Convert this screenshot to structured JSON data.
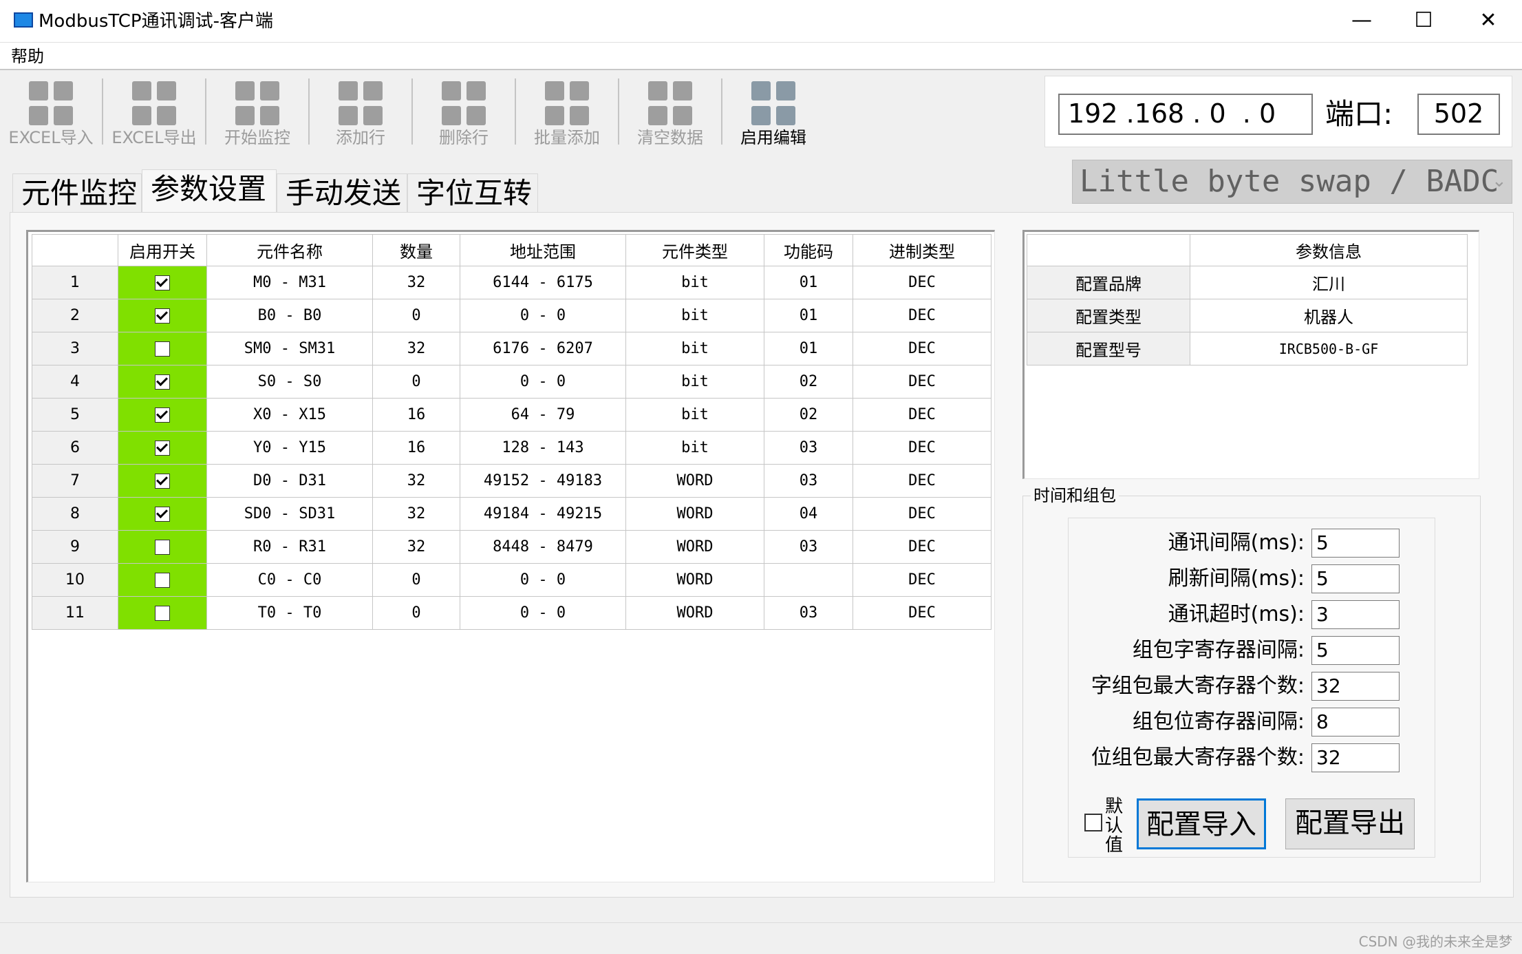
{
  "window": {
    "title": "ModbusTCP通讯调试-客户端",
    "minimize": "—",
    "maximize": "☐",
    "close": "✕"
  },
  "menu": {
    "help": "帮助"
  },
  "toolbar": [
    {
      "label": "EXCEL导入",
      "enabled": false
    },
    {
      "label": "EXCEL导出",
      "enabled": false
    },
    {
      "label": "开始监控",
      "enabled": false
    },
    {
      "label": "添加行",
      "enabled": false
    },
    {
      "label": "删除行",
      "enabled": false
    },
    {
      "label": "批量添加",
      "enabled": false
    },
    {
      "label": "清空数据",
      "enabled": false
    },
    {
      "label": "启用编辑",
      "enabled": true
    }
  ],
  "connection": {
    "ip": "192 .168 . 0  . 0",
    "port_label": "端口:",
    "port": "502"
  },
  "tabs": [
    "元件监控",
    "参数设置",
    "手动发送",
    "字位互转"
  ],
  "active_tab": 1,
  "byte_order": "Little byte swap / BADC",
  "table": {
    "headers": [
      "",
      "启用开关",
      "元件名称",
      "数量",
      "地址范围",
      "元件类型",
      "功能码",
      "进制类型"
    ],
    "rows": [
      {
        "no": "1",
        "on": true,
        "name": "M0 - M31",
        "count": "32",
        "range": "6144 - 6175",
        "type": "bit",
        "func": "01",
        "radix": "DEC"
      },
      {
        "no": "2",
        "on": true,
        "name": "B0 - B0",
        "count": "0",
        "range": "0 - 0",
        "type": "bit",
        "func": "01",
        "radix": "DEC"
      },
      {
        "no": "3",
        "on": false,
        "name": "SM0 - SM31",
        "count": "32",
        "range": "6176 - 6207",
        "type": "bit",
        "func": "01",
        "radix": "DEC"
      },
      {
        "no": "4",
        "on": true,
        "name": "S0 - S0",
        "count": "0",
        "range": "0 - 0",
        "type": "bit",
        "func": "02",
        "radix": "DEC"
      },
      {
        "no": "5",
        "on": true,
        "name": "X0 - X15",
        "count": "16",
        "range": "64 - 79",
        "type": "bit",
        "func": "02",
        "radix": "DEC"
      },
      {
        "no": "6",
        "on": true,
        "name": "Y0 - Y15",
        "count": "16",
        "range": "128 - 143",
        "type": "bit",
        "func": "03",
        "radix": "DEC"
      },
      {
        "no": "7",
        "on": true,
        "name": "D0 - D31",
        "count": "32",
        "range": "49152 - 49183",
        "type": "WORD",
        "func": "03",
        "radix": "DEC"
      },
      {
        "no": "8",
        "on": true,
        "name": "SD0 - SD31",
        "count": "32",
        "range": "49184 - 49215",
        "type": "WORD",
        "func": "04",
        "radix": "DEC"
      },
      {
        "no": "9",
        "on": false,
        "name": "R0 - R31",
        "count": "32",
        "range": "8448 - 8479",
        "type": "WORD",
        "func": "03",
        "radix": "DEC"
      },
      {
        "no": "10",
        "on": false,
        "name": "C0 - C0",
        "count": "0",
        "range": "0 - 0",
        "type": "WORD",
        "func": "",
        "radix": "DEC"
      },
      {
        "no": "11",
        "on": false,
        "name": "T0 - T0",
        "count": "0",
        "range": "0 - 0",
        "type": "WORD",
        "func": "03",
        "radix": "DEC"
      }
    ]
  },
  "params": {
    "header": "参数信息",
    "rows": [
      {
        "key": "配置品牌",
        "value": "汇川"
      },
      {
        "key": "配置类型",
        "value": "机器人"
      },
      {
        "key": "配置型号",
        "value": "IRCB500-B-GF"
      }
    ]
  },
  "timing": {
    "title": "时间和组包",
    "fields": [
      {
        "label": "通讯间隔(ms):",
        "value": "5"
      },
      {
        "label": "刷新间隔(ms):",
        "value": "5"
      },
      {
        "label": "通讯超时(ms):",
        "value": "3"
      },
      {
        "label": "组包字寄存器间隔:",
        "value": "5"
      },
      {
        "label": "字组包最大寄存器个数:",
        "value": "32"
      },
      {
        "label": "组包位寄存器间隔:",
        "value": "8"
      },
      {
        "label": "位组包最大寄存器个数:",
        "value": "32"
      }
    ],
    "default_label": "默认值",
    "import_btn": "配置导入",
    "export_btn": "配置导出"
  },
  "watermark": "CSDN @我的未来全是梦"
}
